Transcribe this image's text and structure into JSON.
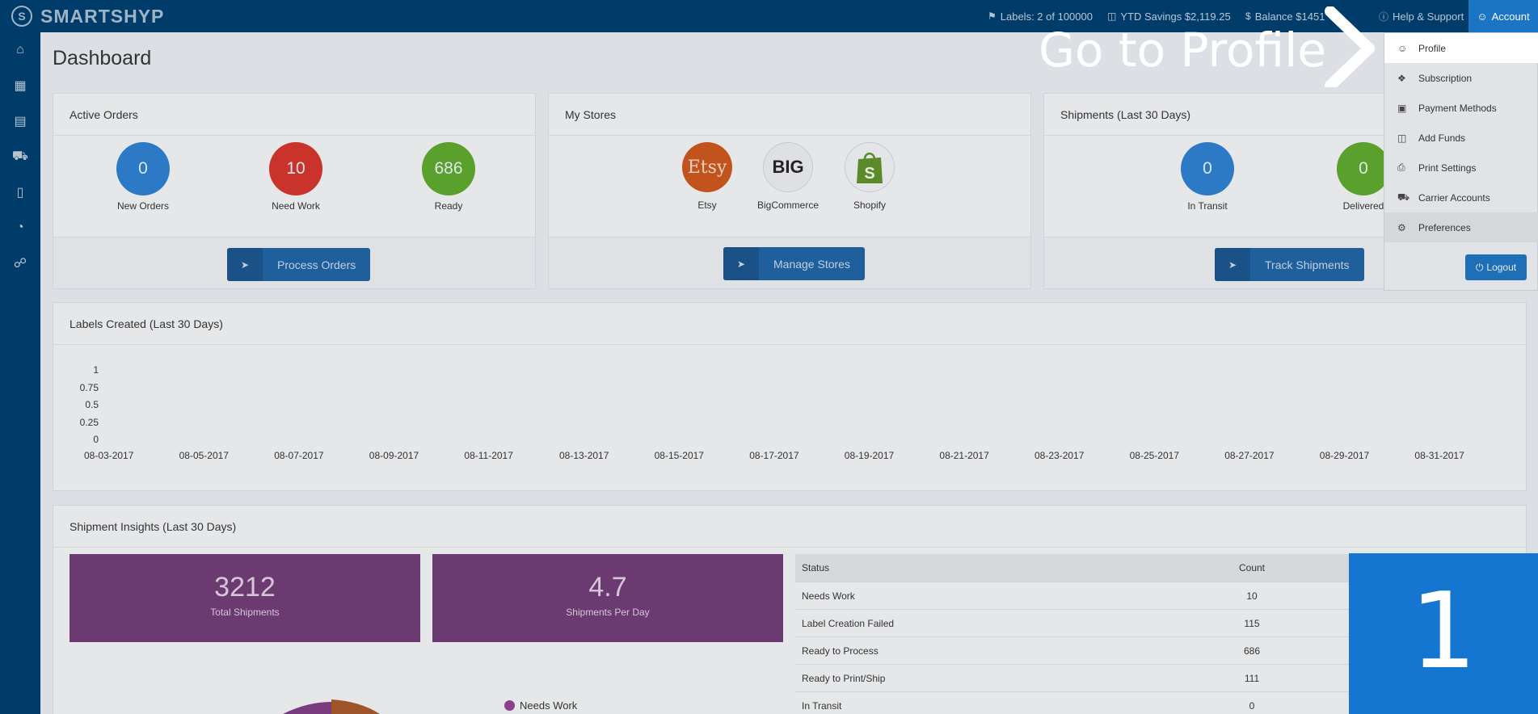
{
  "brand": {
    "name": "SMARTSHYP"
  },
  "topbar": {
    "labels": "Labels: 2 of 100000",
    "savings": "YTD Savings $2,119.25",
    "balance": "Balance $1451",
    "help": "Help & Support",
    "account": "Account"
  },
  "page": {
    "title": "Dashboard"
  },
  "active_orders": {
    "title": "Active Orders",
    "items": [
      {
        "value": "0",
        "label": "New Orders",
        "color": "#2c7ac5"
      },
      {
        "value": "10",
        "label": "Need Work",
        "color": "#c9332c"
      },
      {
        "value": "686",
        "label": "Ready",
        "color": "#5aa02c"
      }
    ],
    "button": "Process Orders"
  },
  "my_stores": {
    "title": "My Stores",
    "stores": [
      {
        "name": "Etsy",
        "logo_text": "Etsy"
      },
      {
        "name": "BigCommerce",
        "logo_text": "BIG"
      },
      {
        "name": "Shopify",
        "logo_text": "S"
      }
    ],
    "button": "Manage Stores"
  },
  "shipments": {
    "title": "Shipments (Last 30 Days)",
    "items": [
      {
        "value": "0",
        "label": "In Transit",
        "color": "#2c7ac5"
      },
      {
        "value": "0",
        "label": "Delivered",
        "color": "#5aa02c"
      }
    ],
    "button": "Track Shipments"
  },
  "labels_chart": {
    "title": "Labels Created (Last 30 Days)"
  },
  "chart_data": {
    "type": "line",
    "title": "Labels Created (Last 30 Days)",
    "y_ticks": [
      "1",
      "0.75",
      "0.5",
      "0.25",
      "0"
    ],
    "x_ticks": [
      "08-03-2017",
      "08-05-2017",
      "08-07-2017",
      "08-09-2017",
      "08-11-2017",
      "08-13-2017",
      "08-15-2017",
      "08-17-2017",
      "08-19-2017",
      "08-21-2017",
      "08-23-2017",
      "08-25-2017",
      "08-27-2017",
      "08-29-2017",
      "08-31-2017"
    ],
    "ylim": [
      0,
      1
    ],
    "series": []
  },
  "insights": {
    "title": "Shipment Insights (Last 30 Days)",
    "total_shipments": {
      "value": "3212",
      "label": "Total Shipments"
    },
    "per_day": {
      "value": "4.7",
      "label": "Shipments Per Day"
    },
    "legend": [
      {
        "label": "Needs Work",
        "color": "#8b3f8f"
      }
    ],
    "table": {
      "headers": [
        "Status",
        "Count"
      ],
      "rows": [
        {
          "status": "Needs Work",
          "count": "10"
        },
        {
          "status": "Label Creation Failed",
          "count": "115"
        },
        {
          "status": "Ready to Process",
          "count": "686"
        },
        {
          "status": "Ready to Print/Ship",
          "count": "111"
        },
        {
          "status": "In Transit",
          "count": "0"
        }
      ]
    }
  },
  "account_menu": {
    "items": [
      "Profile",
      "Subscription",
      "Payment Methods",
      "Add Funds",
      "Print Settings",
      "Carrier Accounts",
      "Preferences"
    ],
    "logout": "Logout"
  },
  "overlay": {
    "callout": "Go to Profile",
    "step": "1"
  }
}
